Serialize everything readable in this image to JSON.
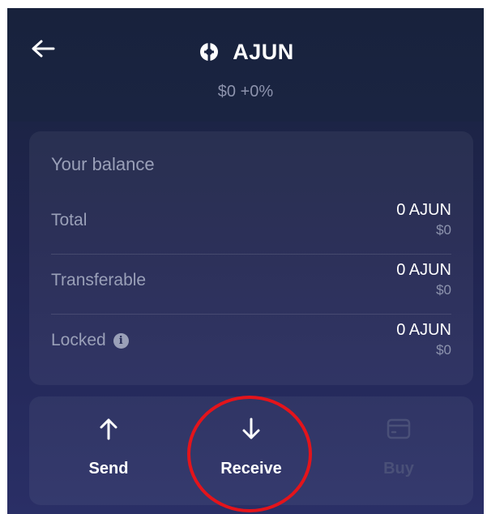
{
  "header": {
    "token_name": "AJUN",
    "price": "$0",
    "change": "+0%"
  },
  "balance": {
    "title": "Your balance",
    "rows": [
      {
        "label": "Total",
        "amount": "0 AJUN",
        "fiat": "$0"
      },
      {
        "label": "Transferable",
        "amount": "0 AJUN",
        "fiat": "$0"
      },
      {
        "label": "Locked",
        "amount": "0 AJUN",
        "fiat": "$0",
        "info_icon": "info-icon"
      }
    ]
  },
  "actions": [
    {
      "label": "Send",
      "icon": "arrow-up-icon",
      "enabled": true
    },
    {
      "label": "Receive",
      "icon": "arrow-down-icon",
      "enabled": true,
      "highlighted": true
    },
    {
      "label": "Buy",
      "icon": "credit-card-icon",
      "enabled": false
    }
  ],
  "colors": {
    "background": "#1f2550",
    "card": "#2b3060",
    "text_primary": "#ffffff",
    "text_secondary": "#9aa0b8",
    "disabled": "#4a5078",
    "highlight": "#e4141b"
  }
}
